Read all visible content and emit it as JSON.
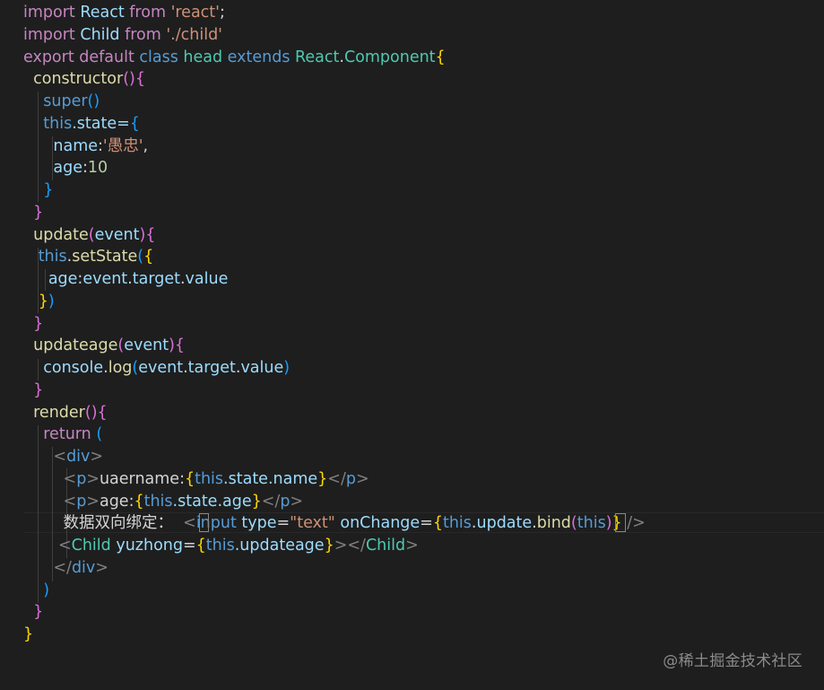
{
  "editor": {
    "lines": [
      [
        [
          "import",
          "tok-import"
        ],
        [
          " React ",
          "tok-id"
        ],
        [
          "from",
          "tok-from"
        ],
        [
          " 'react'",
          "tok-str"
        ],
        [
          ";",
          "tok-plain"
        ]
      ],
      [
        [
          "import",
          "tok-import"
        ],
        [
          " Child ",
          "tok-id"
        ],
        [
          "from",
          "tok-from"
        ],
        [
          " './child'",
          "tok-str"
        ]
      ],
      [
        [
          "export",
          "tok-export"
        ],
        [
          " default ",
          "tok-default"
        ],
        [
          "class",
          "tok-class"
        ],
        [
          " head ",
          "tok-cls"
        ],
        [
          "extends",
          "tok-extends-kw"
        ],
        [
          " React",
          "tok-cls"
        ],
        [
          ".",
          "tok-plain"
        ],
        [
          "Component",
          "tok-cls"
        ],
        [
          "{",
          "tok-brace1"
        ]
      ],
      [
        [
          "  constructor",
          "tok-fn"
        ],
        [
          "(){",
          "tok-brace2"
        ]
      ],
      [
        [
          "    super",
          "tok-class"
        ],
        [
          "()",
          "tok-brace3"
        ]
      ],
      [
        [
          "    this",
          "tok-this"
        ],
        [
          ".state=",
          "tok-id"
        ],
        [
          "{",
          "tok-brace3"
        ]
      ],
      [
        [
          "      name",
          "tok-id"
        ],
        [
          ":",
          "tok-plain"
        ],
        [
          "'愚忠'",
          "tok-str"
        ],
        [
          ",",
          "tok-plain"
        ]
      ],
      [
        [
          "      age",
          "tok-id"
        ],
        [
          ":",
          "tok-plain"
        ],
        [
          "10",
          "tok-num"
        ]
      ],
      [
        [
          "    }",
          "tok-brace3"
        ]
      ],
      [
        [
          "  }",
          "tok-brace2"
        ]
      ],
      [
        [
          "  update",
          "tok-fn"
        ],
        [
          "(",
          "tok-brace2"
        ],
        [
          "event",
          "tok-id"
        ],
        [
          "){",
          "tok-brace2"
        ]
      ],
      [
        [
          "   this",
          "tok-this"
        ],
        [
          ".",
          "tok-plain"
        ],
        [
          "setState",
          "tok-fn"
        ],
        [
          "(",
          "tok-brace3"
        ],
        [
          "{",
          "tok-brace1"
        ]
      ],
      [
        [
          "     age",
          "tok-id"
        ],
        [
          ":",
          "tok-plain"
        ],
        [
          "event",
          "tok-id"
        ],
        [
          ".",
          "tok-plain"
        ],
        [
          "target",
          "tok-id"
        ],
        [
          ".",
          "tok-plain"
        ],
        [
          "value",
          "tok-id"
        ]
      ],
      [
        [
          "   }",
          "tok-brace1"
        ],
        [
          ")",
          "tok-brace3"
        ]
      ],
      [
        [
          "  }",
          "tok-brace2"
        ]
      ],
      [
        [
          "  updateage",
          "tok-fn"
        ],
        [
          "(",
          "tok-brace2"
        ],
        [
          "event",
          "tok-id"
        ],
        [
          "){",
          "tok-brace2"
        ]
      ],
      [
        [
          "    console",
          "tok-id"
        ],
        [
          ".",
          "tok-plain"
        ],
        [
          "log",
          "tok-fn"
        ],
        [
          "(",
          "tok-brace3"
        ],
        [
          "event",
          "tok-id"
        ],
        [
          ".",
          "tok-plain"
        ],
        [
          "target",
          "tok-id"
        ],
        [
          ".",
          "tok-plain"
        ],
        [
          "value",
          "tok-id"
        ],
        [
          ")",
          "tok-brace3"
        ]
      ],
      [
        [
          "  }",
          "tok-brace2"
        ]
      ],
      [
        [
          "  render",
          "tok-fn"
        ],
        [
          "(){",
          "tok-brace2"
        ]
      ],
      [
        [
          "    return",
          "tok-return"
        ],
        [
          " (",
          "tok-brace3"
        ]
      ],
      [
        [
          "      ",
          "tok-plain"
        ],
        [
          "<",
          "tok-angle"
        ],
        [
          "div",
          "tok-tag"
        ],
        [
          ">",
          "tok-angle"
        ]
      ],
      [
        [
          "        ",
          "tok-plain"
        ],
        [
          "<",
          "tok-angle"
        ],
        [
          "p",
          "tok-tag"
        ],
        [
          ">",
          "tok-angle"
        ],
        [
          "uaername:",
          "tok-plain"
        ],
        [
          "{",
          "tok-brace1"
        ],
        [
          "this",
          "tok-this"
        ],
        [
          ".state.name",
          "tok-id"
        ],
        [
          "}",
          "tok-brace1"
        ],
        [
          "</",
          "tok-angle"
        ],
        [
          "p",
          "tok-tag"
        ],
        [
          ">",
          "tok-angle"
        ]
      ],
      [
        [
          "        ",
          "tok-plain"
        ],
        [
          "<",
          "tok-angle"
        ],
        [
          "p",
          "tok-tag"
        ],
        [
          ">",
          "tok-angle"
        ],
        [
          "age:",
          "tok-plain"
        ],
        [
          "{",
          "tok-brace1"
        ],
        [
          "this",
          "tok-this"
        ],
        [
          ".state.age",
          "tok-id"
        ],
        [
          "}",
          "tok-brace1"
        ],
        [
          "</",
          "tok-angle"
        ],
        [
          "p",
          "tok-tag"
        ],
        [
          ">",
          "tok-angle"
        ]
      ],
      [
        [
          "        数据双向绑定：  ",
          "tok-plain"
        ],
        [
          "<",
          "tok-angle"
        ],
        [
          "input",
          "tok-tag"
        ],
        [
          " type",
          "tok-attr"
        ],
        [
          "=",
          "tok-plain"
        ],
        [
          "\"text\"",
          "tok-str"
        ],
        [
          " onChange",
          "tok-attr"
        ],
        [
          "=",
          "tok-plain"
        ],
        [
          "{",
          "tok-brace1"
        ],
        [
          "this",
          "tok-this"
        ],
        [
          ".",
          "tok-plain"
        ],
        [
          "update",
          "tok-id"
        ],
        [
          ".",
          "tok-plain"
        ],
        [
          "bind",
          "tok-fn"
        ],
        [
          "(",
          "tok-brace2"
        ],
        [
          "this",
          "tok-this"
        ],
        [
          ")",
          "tok-brace2"
        ],
        [
          "}",
          "tok-brace1"
        ],
        [
          " />",
          "tok-angle"
        ]
      ],
      [
        [
          "       ",
          "tok-plain"
        ],
        [
          "<",
          "tok-angle"
        ],
        [
          "Child",
          "tok-cls"
        ],
        [
          " yuzhong",
          "tok-attr"
        ],
        [
          "=",
          "tok-plain"
        ],
        [
          "{",
          "tok-brace1"
        ],
        [
          "this",
          "tok-this"
        ],
        [
          ".updateage",
          "tok-id"
        ],
        [
          "}",
          "tok-brace1"
        ],
        [
          "></",
          "tok-angle"
        ],
        [
          "Child",
          "tok-cls"
        ],
        [
          ">",
          "tok-angle"
        ]
      ],
      [
        [
          "      ",
          "tok-plain"
        ],
        [
          "</",
          "tok-angle"
        ],
        [
          "div",
          "tok-tag"
        ],
        [
          ">",
          "tok-angle"
        ]
      ],
      [
        [
          "    )",
          "tok-brace3"
        ]
      ],
      [
        [
          "  }",
          "tok-brace2"
        ]
      ],
      [
        [
          "}",
          "tok-brace1"
        ]
      ]
    ]
  },
  "watermark": {
    "text": "@稀土掘金技术社区"
  },
  "colors": {
    "background": "#1e1e1e",
    "keyword_purple": "#c586c0",
    "keyword_blue": "#569cd6",
    "string": "#ce9178",
    "number": "#b5cea8",
    "function": "#dcdcaa",
    "identifier": "#9cdcfe",
    "class": "#4ec9b0",
    "bracket_gold": "#ffd700",
    "bracket_orchid": "#da70d6",
    "bracket_blue": "#179fff"
  }
}
